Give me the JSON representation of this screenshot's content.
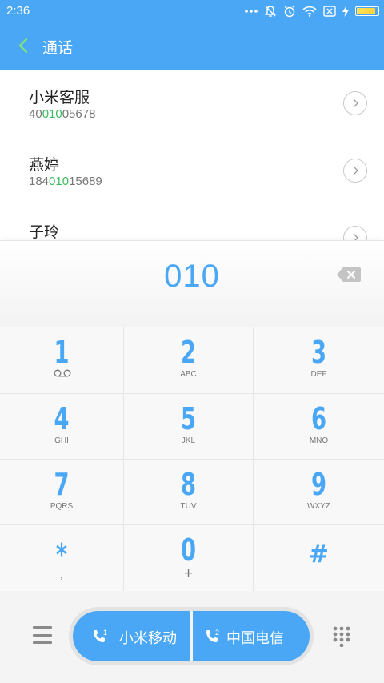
{
  "status_bar": {
    "time": "2:36",
    "icons": [
      "more-dots-icon",
      "mute-icon",
      "alarm-icon",
      "wifi-icon",
      "no-sim-icon",
      "charging-icon",
      "battery-icon"
    ],
    "battery_level": 0.9
  },
  "header": {
    "title": "通话",
    "back_icon": "chevron-left-icon"
  },
  "contacts": [
    {
      "name": "小米客服",
      "number_pre": "40",
      "number_match": "010",
      "number_post": "05678"
    },
    {
      "name": "燕婷",
      "number_pre": "184",
      "number_match": "010",
      "number_post": "15689"
    },
    {
      "name": "子玲",
      "number_pre": "",
      "number_match": "",
      "number_post": ""
    }
  ],
  "dialer": {
    "input": "010",
    "backspace_icon": "backspace-icon"
  },
  "keypad": [
    {
      "digit": "1",
      "sub": "",
      "sub_icon": "voicemail-icon"
    },
    {
      "digit": "2",
      "sub": "ABC"
    },
    {
      "digit": "3",
      "sub": "DEF"
    },
    {
      "digit": "4",
      "sub": "GHI"
    },
    {
      "digit": "5",
      "sub": "JKL"
    },
    {
      "digit": "6",
      "sub": "MNO"
    },
    {
      "digit": "7",
      "sub": "PQRS"
    },
    {
      "digit": "8",
      "sub": "TUV"
    },
    {
      "digit": "9",
      "sub": "WXYZ"
    },
    {
      "digit": "*",
      "sub": ","
    },
    {
      "digit": "0",
      "sub": "+"
    },
    {
      "digit": "#",
      "sub": ""
    }
  ],
  "bottom_bar": {
    "menu_icon": "menu-icon",
    "sim1_index": "1",
    "sim1_label": "小米移动",
    "sim2_index": "2",
    "sim2_label": "中国电信",
    "dialpad_icon": "dialpad-icon"
  },
  "colors": {
    "accent": "#4aa7f5",
    "match_highlight": "#3dbb5f"
  }
}
